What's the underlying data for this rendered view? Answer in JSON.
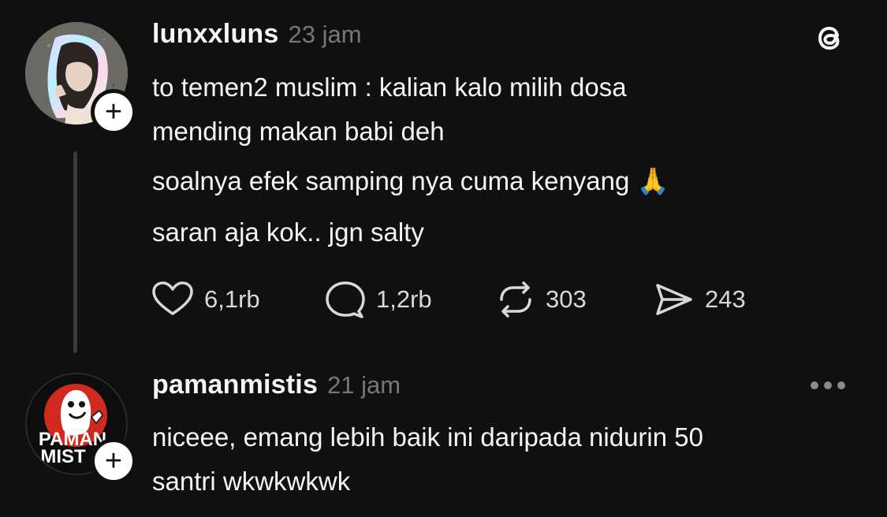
{
  "posts": [
    {
      "username": "lunxxluns",
      "time": "23 jam",
      "text_lines": [
        "to temen2 muslim : kalian kalo milih dosa",
        "mending makan babi deh",
        "soalnya efek samping nya cuma kenyang 🙏",
        "saran aja kok.. jgn salty"
      ],
      "likes": "6,1rb",
      "replies": "1,2rb",
      "reposts": "303",
      "shares": "243"
    },
    {
      "username": "pamanmistis",
      "time": "21 jam",
      "avatar_text_1": "PAMAN",
      "avatar_text_2": "MIST",
      "text_lines": [
        "niceee, emang lebih baik ini daripada nidurin 50",
        "santri wkwkwkwk"
      ]
    }
  ],
  "follow_badge_symbol": "+",
  "icons": {
    "app_logo": "threads-logo-icon",
    "like": "heart-icon",
    "reply": "comment-bubble-icon",
    "repost": "repost-icon",
    "share": "send-icon",
    "more": "more-options-icon"
  },
  "colors": {
    "background": "#101010",
    "text_primary": "#f3f5f7",
    "text_muted": "#777777"
  }
}
